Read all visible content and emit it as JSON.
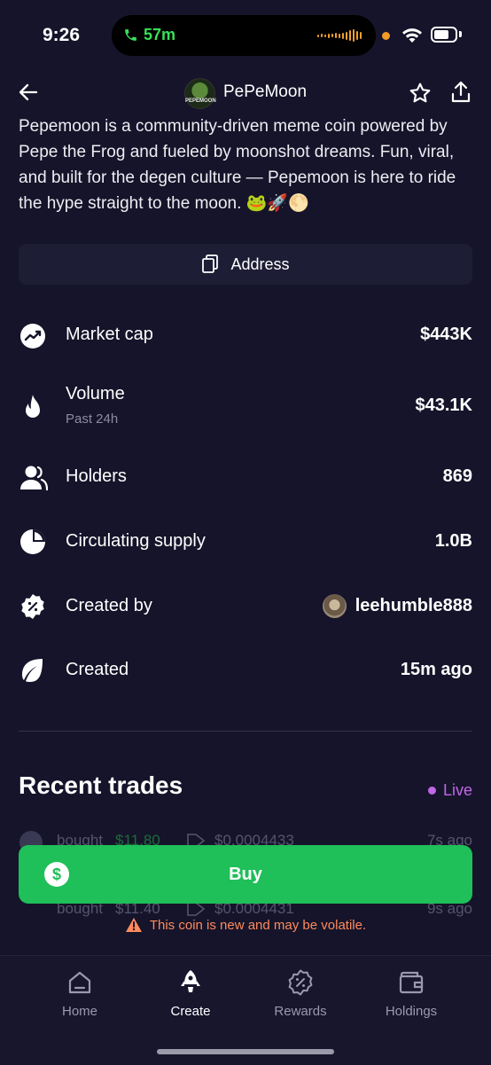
{
  "status_bar": {
    "time": "9:26",
    "call_duration": "57m"
  },
  "header": {
    "coin_name": "PePeMoon",
    "logo_text": "PEPEMOON"
  },
  "description": "Pepemoon is a community-driven meme coin powered by Pepe the Frog and fueled by moonshot dreams. Fun, viral, and built for the degen culture — Pepemoon is here to ride the hype straight to the moon. 🐸🚀🌕",
  "address_button": "Address",
  "stats": {
    "market_cap": {
      "label": "Market cap",
      "value": "$443K"
    },
    "volume": {
      "label": "Volume",
      "sub": "Past 24h",
      "value": "$43.1K"
    },
    "holders": {
      "label": "Holders",
      "value": "869"
    },
    "circulating_supply": {
      "label": "Circulating supply",
      "value": "1.0B"
    },
    "created_by": {
      "label": "Created by",
      "value": "leehumble888"
    },
    "created": {
      "label": "Created",
      "value": "15m ago"
    }
  },
  "recent_trades": {
    "title": "Recent trades",
    "live_label": "Live",
    "rows": [
      {
        "action": "bought",
        "amount": "$11.80",
        "price": "$0.0004433",
        "time": "7s ago"
      },
      {
        "action": "bought",
        "amount": "$11.40",
        "price": "$0.0004431",
        "time": "9s ago"
      }
    ]
  },
  "buy_button": {
    "label": "Buy",
    "icon": "$"
  },
  "warning": "This coin is new and may be volatile.",
  "tabs": [
    {
      "label": "Home",
      "icon": "home-icon"
    },
    {
      "label": "Create",
      "icon": "rocket-icon"
    },
    {
      "label": "Rewards",
      "icon": "percent-badge-icon"
    },
    {
      "label": "Holdings",
      "icon": "wallet-icon"
    }
  ],
  "colors": {
    "background": "#15142a",
    "accent_green": "#1fbf59",
    "live_purple": "#c167e6",
    "warning_orange": "#ff8a5c"
  }
}
